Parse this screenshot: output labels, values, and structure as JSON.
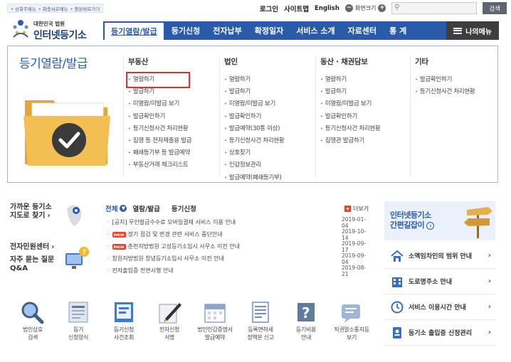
{
  "top": {
    "util_links": [
      "• 상회주메뉴",
      "• 화충서로메뉴",
      "• 중본바로가기"
    ],
    "login": "로그인",
    "sitemap": "사이트맵",
    "english": "English",
    "zoom_label": "화면크기",
    "search_placeholder": "",
    "search_button": "검색"
  },
  "logo": {
    "line1": "대한민국 법원",
    "line2": "인터넷등기소"
  },
  "nav": {
    "items": [
      "등기열람/발급",
      "등기신청",
      "전자납부",
      "확정일자",
      "서비스 소개",
      "자료센터",
      "통 계"
    ],
    "my_menu": "나의메뉴"
  },
  "mega": {
    "title": "등기열람/발급",
    "columns": [
      {
        "heading": "부동산",
        "items": [
          "열람하기",
          "발급하기",
          "미열람/미발급 보기",
          "발급확인하기",
          "등기신청사건 처리현황",
          "집행 등 전자제출용 발급",
          "폐쇄등기부 등 발급예약",
          "부동산거래 체크리스트"
        ]
      },
      {
        "heading": "법인",
        "items": [
          "열람하기",
          "발급하기",
          "미열람/미발급 보기",
          "발급확인하기",
          "발급예약(30통 이상)",
          "등기신청사건 처리현황",
          "상호찾기",
          "인감정보관리",
          "발급예약(폐쇄등기부)"
        ]
      },
      {
        "heading": "동산 · 채권담보",
        "items": [
          "열람하기",
          "발급하기",
          "미열람/미발급 보기",
          "발급확인하기",
          "등기신청사건 처리현황",
          "집행관 발급하기"
        ]
      },
      {
        "heading": "기타",
        "items": [
          "발급확인하기",
          "등기신청사건 처리현황"
        ]
      }
    ]
  },
  "quick": {
    "nearby_line1": "가까운 등기소",
    "nearby_line2": "지도로 찾기",
    "civil_center": "전자민원센터",
    "faq_line1": "자주 묻는 질문",
    "faq_line2": "Q&A"
  },
  "news": {
    "tabs": [
      "전체",
      "열람/발급",
      "등기신청"
    ],
    "more": "더보기",
    "badge": "new",
    "items": [
      {
        "text": "[공지] 무인발급수수료 모바일결제 서비스 이용 안내",
        "date": "2019-01-04",
        "new": false
      },
      {
        "text": "정기 점검 및 변경 관련 서비스 중단안내",
        "date": "2019-10-14",
        "new": true
      },
      {
        "text": "춘천지방법원 고성등기소임시 사무소 이전 안내",
        "date": "2019-09-17",
        "new": true
      },
      {
        "text": "창원지방법원 창녕등기소임시 사무소 이전 안내",
        "date": "2019-09-04",
        "new": false
      },
      {
        "text": "전자출입증 전면시행 안내",
        "date": "2019-08-21",
        "new": false
      }
    ]
  },
  "banner": {
    "line1": "인터넷등기소",
    "line2": "간편길잡이"
  },
  "right_links": [
    "소액임차인의 범위 안내",
    "도로명주소 안내",
    "서비스 이용시간 안내",
    "등기소 출입증 신청관리"
  ],
  "bottom_icons": [
    {
      "label": "법인상호\n검색",
      "icon": "search-corp-icon"
    },
    {
      "label": "등기\n신청양식",
      "icon": "form-icon"
    },
    {
      "label": "등기신청\n사건조회",
      "icon": "case-icon"
    },
    {
      "label": "전자신청\n서명",
      "icon": "pen-icon"
    },
    {
      "label": "법인인감증명서\n발급예약",
      "icon": "calendar-icon"
    },
    {
      "label": "등록면허세\n정액분 신고",
      "icon": "doc-icon"
    },
    {
      "label": "등기비용\n안내",
      "icon": "question-icon"
    },
    {
      "label": "직권말소통지등\n보기",
      "icon": "notice-icon"
    }
  ],
  "colors": {
    "primary": "#2a5ba8",
    "accent_red": "#e4442b"
  }
}
